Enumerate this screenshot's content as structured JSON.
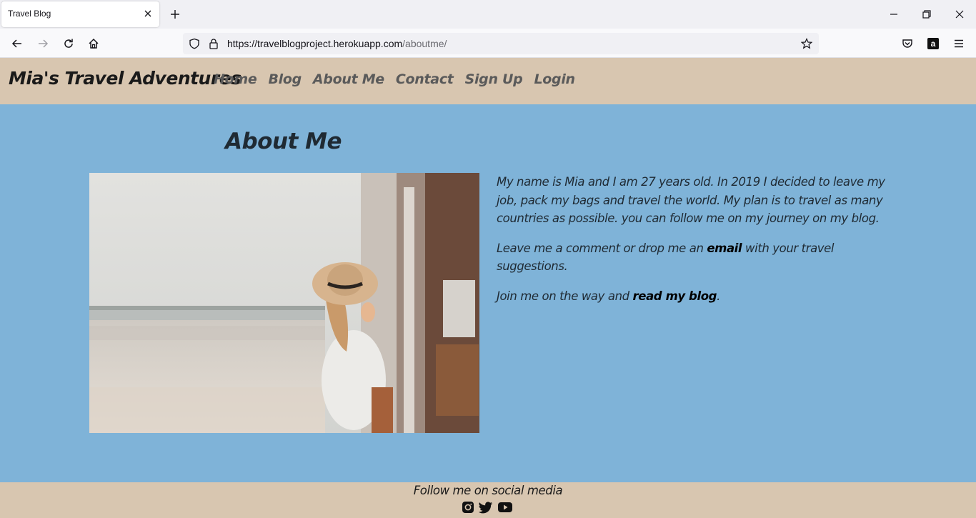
{
  "browser": {
    "tab_title": "Travel Blog",
    "url_main": "https://travelblogproject.herokuapp.com",
    "url_path": "/aboutme/"
  },
  "site": {
    "brand": "Mia's Travel Adventures",
    "nav": [
      "Home",
      "Blog",
      "About Me",
      "Contact",
      "Sign Up",
      "Login"
    ]
  },
  "about": {
    "heading": "About Me",
    "para1": "My name is Mia and I am 27 years old. In 2019 I decided to leave my job, pack my bags and travel the world. My plan is to travel as many countries as possible. you can follow me on my journey on my blog.",
    "para2_before": "Leave me a comment or drop me an ",
    "para2_link": "email",
    "para2_after": " with your travel suggestions.",
    "para3_before": "Join me on the way and ",
    "para3_link": "read my blog",
    "para3_after": "."
  },
  "footer": {
    "title": "Follow me on social media",
    "icons": [
      "instagram-icon",
      "twitter-icon",
      "youtube-icon"
    ]
  },
  "colors": {
    "header_bg": "#d8c6b0",
    "content_bg": "#7fb3d8"
  }
}
